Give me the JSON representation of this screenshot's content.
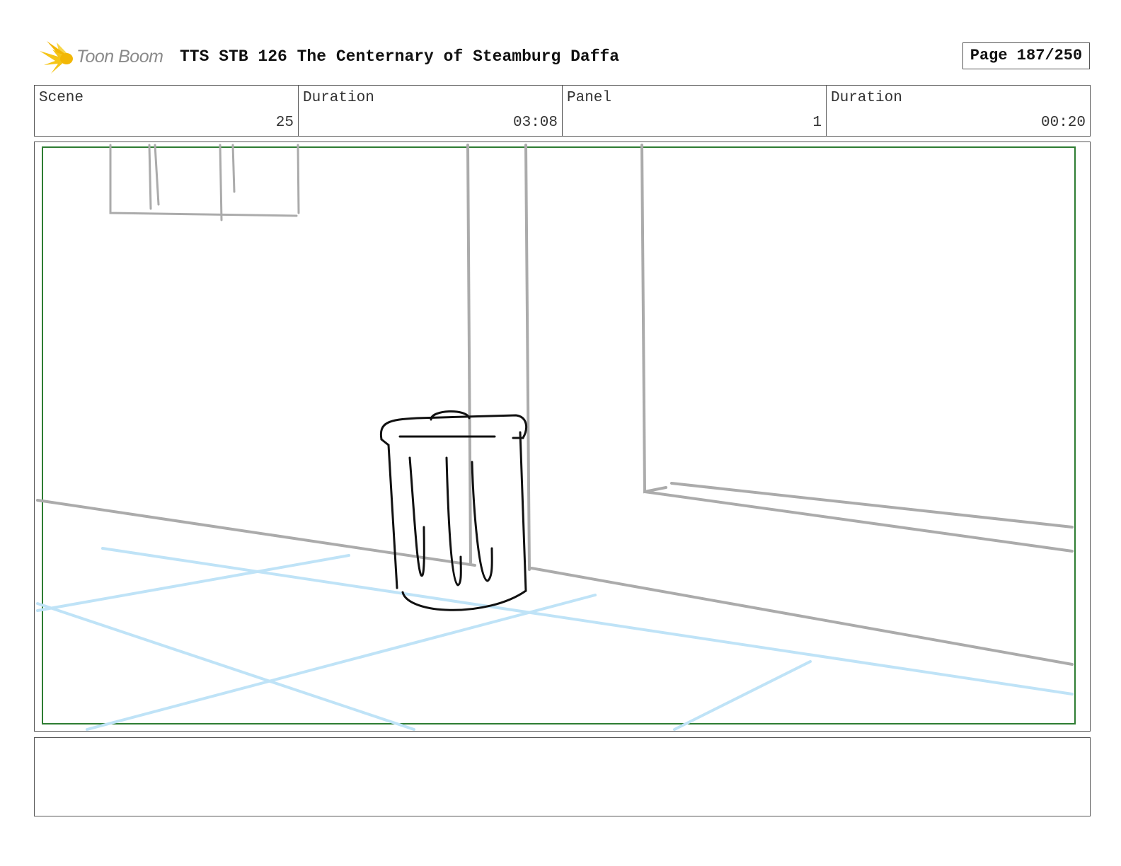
{
  "header": {
    "logo_text": "Toon Boom",
    "title": "TTS STB 126 The Centernary of Steamburg Daffa",
    "page": "Page 187/250"
  },
  "info": {
    "scene_label": "Scene",
    "scene_value": "25",
    "scene_duration_label": "Duration",
    "scene_duration_value": "03:08",
    "panel_label": "Panel",
    "panel_value": "1",
    "panel_duration_label": "Duration",
    "panel_duration_value": "00:20"
  },
  "colors": {
    "logo_star": "#f5c518",
    "safe_area_border": "#2e7d32",
    "sketch_gray": "#ababab",
    "sketch_black": "#111111",
    "floor_blue": "#bfe3f7"
  },
  "notes": {
    "text": ""
  }
}
